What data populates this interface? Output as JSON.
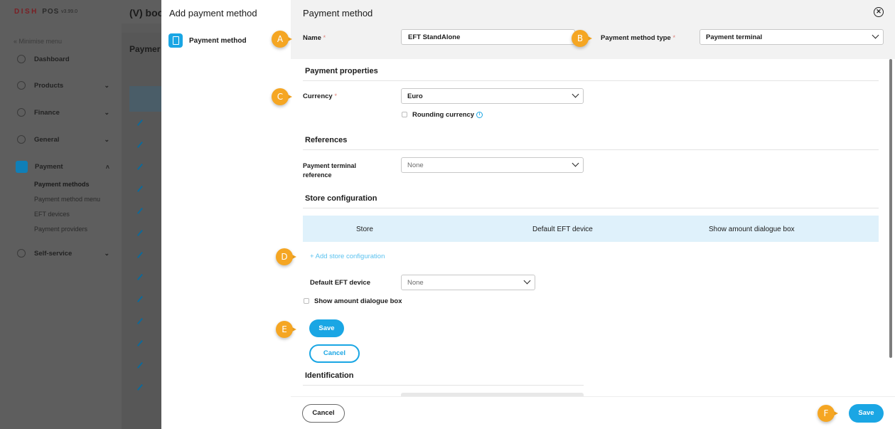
{
  "app": {
    "logo": "DISH",
    "logo_pos": "POS",
    "version": "v3.99.0",
    "title": "(V) boo",
    "page_title": "Paymer"
  },
  "sidebar": {
    "minimise": "Minimise menu",
    "items": [
      {
        "label": "Dashboard"
      },
      {
        "label": "Products"
      },
      {
        "label": "Finance"
      },
      {
        "label": "General"
      },
      {
        "label": "Payment"
      },
      {
        "label": "Self-service"
      }
    ],
    "payment_sub": [
      {
        "label": "Payment methods"
      },
      {
        "label": "Payment method menu"
      },
      {
        "label": "EFT devices"
      },
      {
        "label": "Payment providers"
      }
    ]
  },
  "steps": {
    "title": "Add payment method",
    "item": "Payment method"
  },
  "modal": {
    "title": "Payment method",
    "name_label": "Name",
    "name_value": "EFT StandAlone",
    "type_label": "Payment method type",
    "type_value": "Payment terminal",
    "section_payment_properties": "Payment properties",
    "currency_label": "Currency",
    "currency_value": "Euro",
    "rounding_currency": "Rounding currency",
    "section_references": "References",
    "terminal_ref_label_1": "Payment terminal",
    "terminal_ref_label_2": "reference",
    "terminal_ref_value": "None",
    "section_store_config": "Store configuration",
    "table_headers": [
      "Store",
      "Default EFT device",
      "Show amount dialogue box"
    ],
    "add_store_config": "+ Add store configuration",
    "default_eft_label": "Default EFT device",
    "default_eft_value": "None",
    "show_amount_dialogue": "Show amount dialogue box",
    "inner_save": "Save",
    "inner_cancel": "Cancel",
    "section_identification": "Identification",
    "footer_cancel": "Cancel",
    "footer_save": "Save",
    "required_mark": "*"
  },
  "markers": [
    "A",
    "B",
    "C",
    "D",
    "E",
    "F"
  ],
  "colors": {
    "accent": "#1aa6e4",
    "marker": "#f5a623",
    "table_header_bg": "#dff1fb",
    "link": "#5ac2ef"
  },
  "icons": [
    "close-icon",
    "chevron-down-icon",
    "info-icon",
    "payment-method-icon"
  ]
}
